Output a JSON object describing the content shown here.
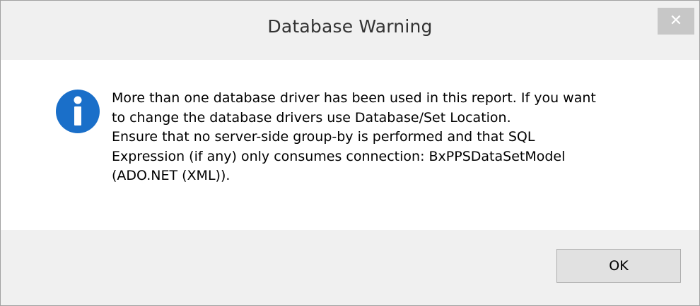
{
  "dialog": {
    "title": "Database Warning",
    "close_glyph": "✕",
    "icon": "info-icon",
    "message_lines": [
      "More than one database driver has been used in this report. If you want",
      "to change the database drivers use Database/Set Location.",
      "Ensure that no server-side group-by is performed and that SQL",
      "Expression (if any) only consumes connection: BxPPSDataSetModel",
      "(ADO.NET (XML))."
    ],
    "ok_label": "OK"
  },
  "colors": {
    "title_bar": "#f0f0f0",
    "close_button": "#c7c7c7",
    "info_icon": "#1a6fc9",
    "footer": "#f0f0f0"
  }
}
